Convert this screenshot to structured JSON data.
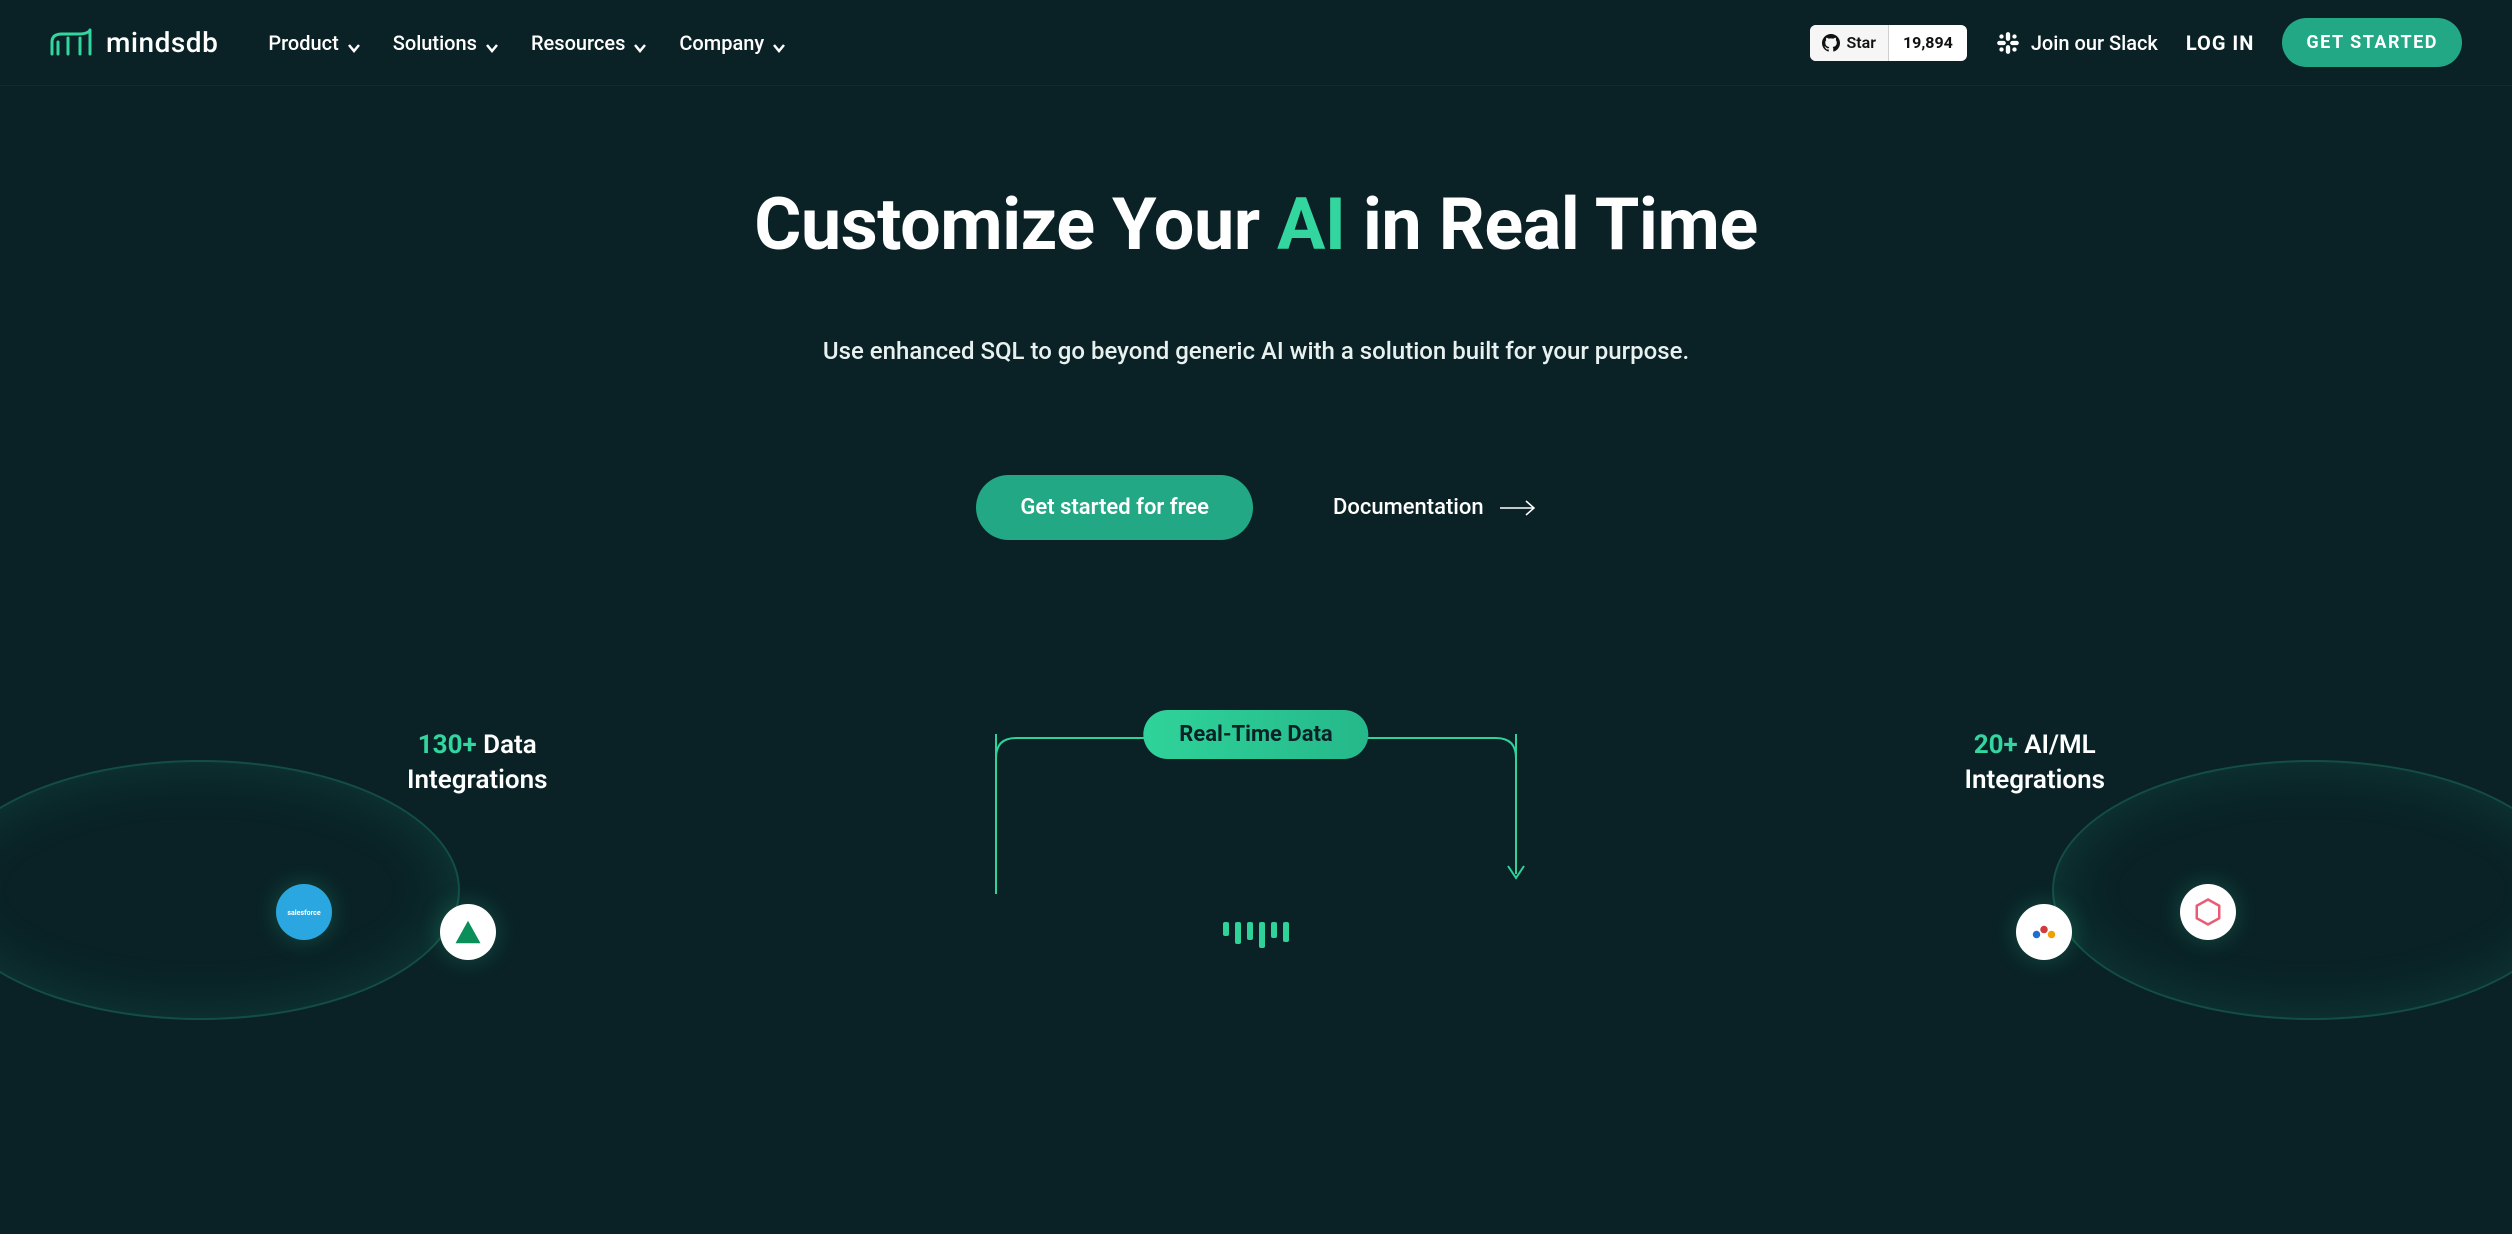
{
  "brand": {
    "name": "mindsdb"
  },
  "nav": {
    "items": [
      {
        "label": "Product"
      },
      {
        "label": "Solutions"
      },
      {
        "label": "Resources"
      },
      {
        "label": "Company"
      }
    ],
    "github": {
      "star_label": "Star",
      "count": "19,894"
    },
    "slack_label": "Join our Slack",
    "login_label": "LOG IN",
    "get_started_label": "GET STARTED"
  },
  "hero": {
    "title_pre": "Customize Your ",
    "title_accent": "AI",
    "title_post": " in Real Time",
    "subtitle": "Use enhanced SQL to go beyond generic AI with a solution built for your purpose.",
    "cta_primary": "Get started for free",
    "cta_docs": "Documentation"
  },
  "diagram": {
    "pill": "Real-Time Data",
    "left": {
      "accent": "130+",
      "rest_line1": " Data",
      "line2": "Integrations"
    },
    "right": {
      "accent": "20+",
      "rest_line1": " AI/ML",
      "line2": "Integrations"
    }
  },
  "colors": {
    "accent": "#33d69f",
    "bg": "#0a2226",
    "button": "#22a884"
  }
}
